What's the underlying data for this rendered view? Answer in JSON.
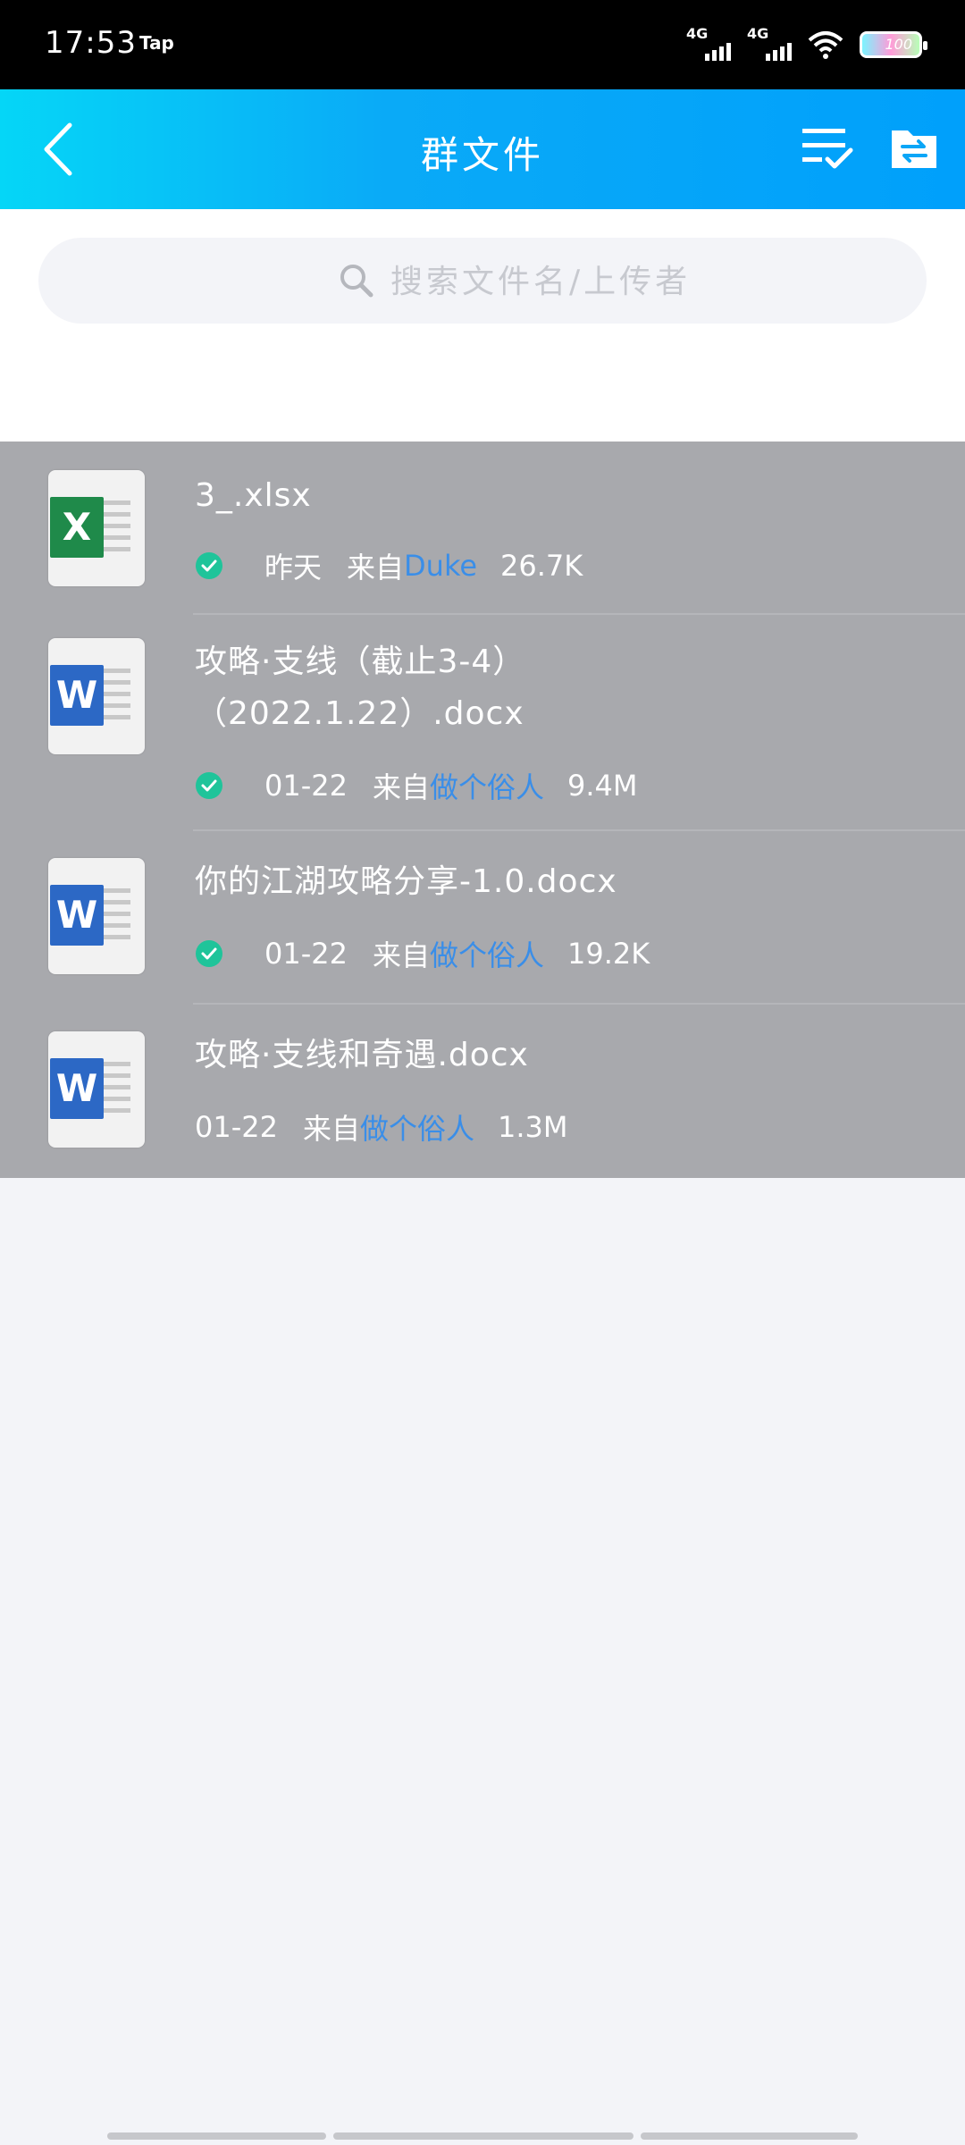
{
  "status_bar": {
    "time": "17:53",
    "app_indicator": "Tap",
    "signal_1": "4G",
    "signal_2": "4G",
    "battery_level": "100"
  },
  "header": {
    "title": "群文件"
  },
  "search": {
    "placeholder": "搜索文件名/上传者"
  },
  "files": [
    {
      "name": "3_.xlsx",
      "type": "excel",
      "badge": "X",
      "date": "昨天",
      "from_label": "来自",
      "uploader": "Duke",
      "size": "26.7K",
      "downloaded": true
    },
    {
      "name": "攻略·支线（截止3-4）（2022.1.22）.docx",
      "type": "word",
      "badge": "W",
      "date": "01-22",
      "from_label": "来自",
      "uploader": "做个俗人",
      "size": "9.4M",
      "downloaded": true
    },
    {
      "name": "你的江湖攻略分享-1.0.docx",
      "type": "word",
      "badge": "W",
      "date": "01-22",
      "from_label": "来自",
      "uploader": "做个俗人",
      "size": "19.2K",
      "downloaded": true
    },
    {
      "name": "攻略·支线和奇遇.docx",
      "type": "word",
      "badge": "W",
      "date": "01-22",
      "from_label": "来自",
      "uploader": "做个俗人",
      "size": "1.3M",
      "downloaded": false
    }
  ],
  "colors": {
    "header_start": "#05d6f7",
    "header_end": "#00a0fb",
    "uploader_link": "#3a8ee8",
    "check_green": "#1fc49a",
    "excel_green": "#1f8a4a",
    "word_blue": "#2c68c5"
  },
  "icons": {
    "back": "chevron-left-icon",
    "multi_select": "list-check-icon",
    "folder": "folder-transfer-icon",
    "search": "search-icon",
    "check": "check-circle-icon"
  }
}
